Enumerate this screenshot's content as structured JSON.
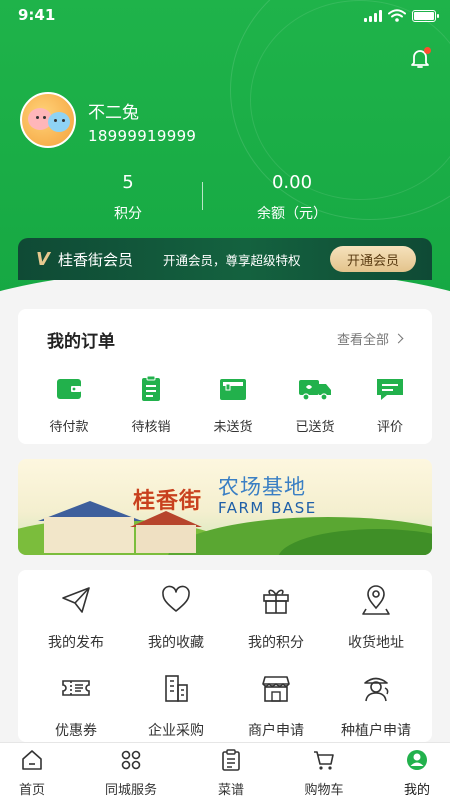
{
  "status_bar": {
    "time": "9:41"
  },
  "profile": {
    "name": "不二兔",
    "phone": "18999919999"
  },
  "stats": [
    {
      "value": "5",
      "label": "积分"
    },
    {
      "value": "0.00",
      "label": "余额（元）"
    }
  ],
  "vip": {
    "logo": "V",
    "title": "桂香街会员",
    "desc": "开通会员，尊享超级特权",
    "button": "开通会员"
  },
  "orders": {
    "title": "我的订单",
    "more": "查看全部",
    "items": [
      {
        "label": "待付款",
        "icon": "wallet-icon"
      },
      {
        "label": "待核销",
        "icon": "clipboard-icon"
      },
      {
        "label": "未送货",
        "icon": "box-icon"
      },
      {
        "label": "已送货",
        "icon": "truck-icon"
      },
      {
        "label": "评价",
        "icon": "comment-icon"
      }
    ]
  },
  "banner": {
    "brand": "桂香街",
    "title_cn": "农场基地",
    "title_en": "FARM BASE"
  },
  "services": [
    {
      "label": "我的发布",
      "icon": "paper-plane-icon"
    },
    {
      "label": "我的收藏",
      "icon": "heart-icon"
    },
    {
      "label": "我的积分",
      "icon": "gift-icon"
    },
    {
      "label": "收货地址",
      "icon": "location-icon"
    },
    {
      "label": "优惠券",
      "icon": "coupon-icon"
    },
    {
      "label": "企业采购",
      "icon": "building-icon"
    },
    {
      "label": "商户申请",
      "icon": "store-icon"
    },
    {
      "label": "种植户申请",
      "icon": "farmer-icon"
    }
  ],
  "tabbar": [
    {
      "label": "首页",
      "icon": "home-icon"
    },
    {
      "label": "同城服务",
      "icon": "grid-icon"
    },
    {
      "label": "菜谱",
      "icon": "recipe-icon"
    },
    {
      "label": "购物车",
      "icon": "cart-icon"
    },
    {
      "label": "我的",
      "icon": "user-icon",
      "active": true
    }
  ],
  "colors": {
    "primary_green": "#1fb34a",
    "vip_dark": "#0f4a35",
    "vip_gold": "#e3c38c",
    "icon_green": "#22b14c"
  }
}
